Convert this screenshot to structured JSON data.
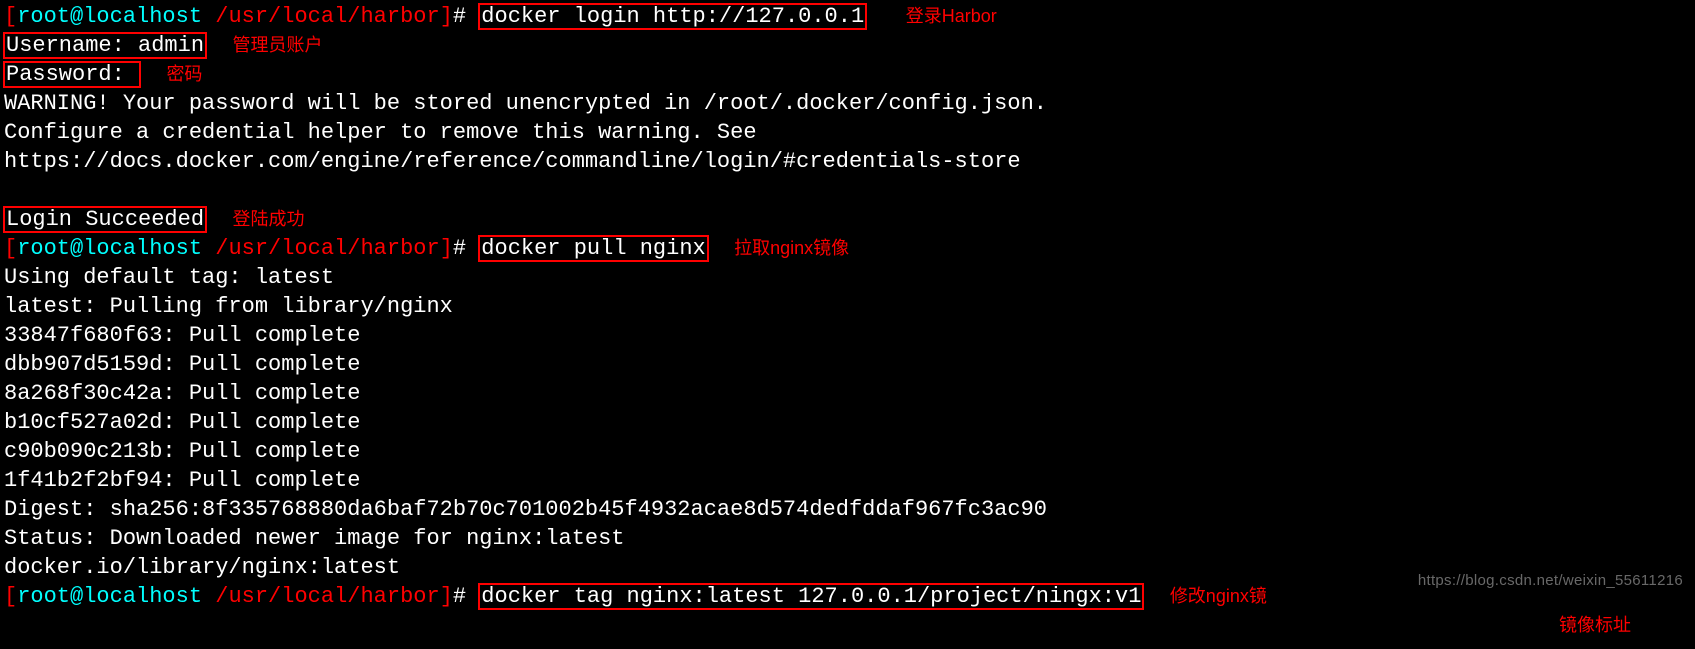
{
  "prompt": {
    "bracket_open": "[",
    "user_at_host": "root@localhost",
    "path": " /usr/local/harbor",
    "bracket_close": "]",
    "hash": "# "
  },
  "cmd1": {
    "text": "docker login http://127.0.0.1",
    "anno": "登录Harbor"
  },
  "line_username": "Username: admin",
  "anno_username": "管理员账户",
  "line_password": "Password: ",
  "anno_password": "密码",
  "warn1": "WARNING! Your password will be stored unencrypted in /root/.docker/config.json.",
  "warn2": "Configure a credential helper to remove this warning. See",
  "warn3": "https://docs.docker.com/engine/reference/commandline/login/#credentials-store",
  "blank": " ",
  "login_succeeded": "Login Succeeded",
  "anno_login": "登陆成功",
  "cmd2": {
    "text": "docker pull nginx",
    "anno": "拉取nginx镜像"
  },
  "pull": {
    "l1": "Using default tag: latest",
    "l2": "latest: Pulling from library/nginx",
    "l3": "33847f680f63: Pull complete",
    "l4": "dbb907d5159d: Pull complete",
    "l5": "8a268f30c42a: Pull complete",
    "l6": "b10cf527a02d: Pull complete",
    "l7": "c90b090c213b: Pull complete",
    "l8": "1f41b2f2bf94: Pull complete",
    "l9": "Digest: sha256:8f335768880da6baf72b70c701002b45f4932acae8d574dedfddaf967fc3ac90",
    "l10": "Status: Downloaded newer image for nginx:latest",
    "l11": "docker.io/library/nginx:latest"
  },
  "cmd3": {
    "text": "docker tag nginx:latest 127.0.0.1/project/ningx:v1",
    "anno1": "修改nginx镜",
    "anno2": "镜像标址"
  },
  "watermark": "https://blog.csdn.net/weixin_55611216"
}
